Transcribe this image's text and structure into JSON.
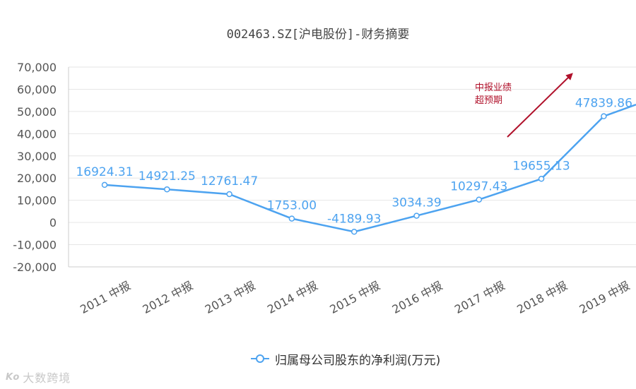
{
  "title": "002463.SZ[沪电股份]-财务摘要",
  "annotation": {
    "line1": "中报业绩",
    "line2": "超预期",
    "color": "#b0102a"
  },
  "legend": {
    "label": "归属母公司股东的净利润(万元)",
    "icon": "line-circle-marker-icon"
  },
  "watermark": {
    "logo": "Ko",
    "text": "大数跨境"
  },
  "colors": {
    "series": "#4da3f0",
    "label": "#4da3f0",
    "axis_text": "#555555",
    "grid": "#e6e6e6"
  },
  "chart_data": {
    "type": "line",
    "title": "002463.SZ[沪电股份]-财务摘要",
    "xlabel": "",
    "ylabel": "",
    "categories": [
      "2011 中报",
      "2012 中报",
      "2013 中报",
      "2014 中报",
      "2015 中报",
      "2016 中报",
      "2017 中报",
      "2018 中报",
      "2019 中报"
    ],
    "ylim": [
      -20000,
      70000
    ],
    "yticks": [
      70000,
      60000,
      50000,
      40000,
      30000,
      20000,
      10000,
      0,
      -10000,
      -20000
    ],
    "ytick_labels": [
      "70,000",
      "60,000",
      "50,000",
      "40,000",
      "30,000",
      "20,000",
      "10,000",
      "0",
      "-10,000",
      "-20,000"
    ],
    "series": [
      {
        "name": "归属母公司股东的净利润(万元)",
        "values": [
          16924.31,
          14921.25,
          12761.47,
          1753.0,
          -4189.93,
          3034.39,
          10297.43,
          19655.13,
          47839.86
        ],
        "labels": [
          "16924.31",
          "14921.25",
          "12761.47",
          "1753.00",
          "-4189.93",
          "3034.39",
          "10297.43",
          "19655.13",
          "47839.86"
        ]
      }
    ],
    "grid": true,
    "legend_position": "bottom"
  }
}
